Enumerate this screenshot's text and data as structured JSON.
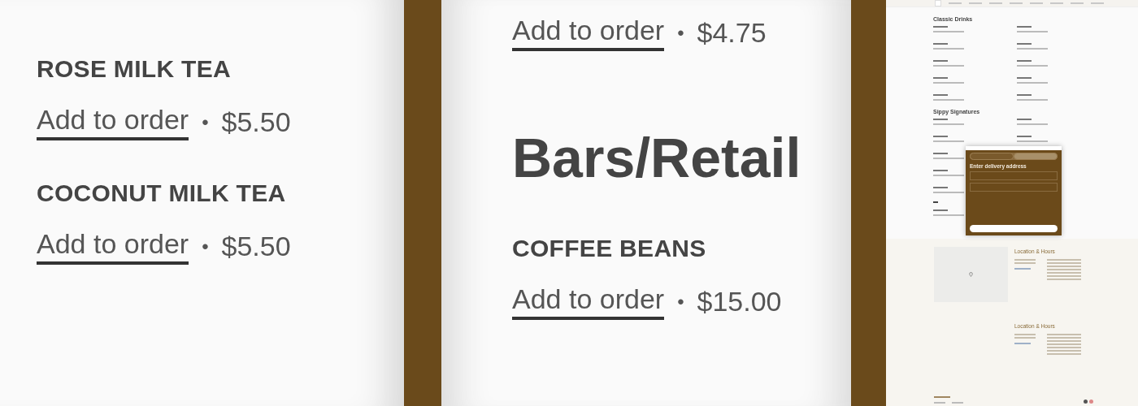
{
  "panel_left": {
    "items": [
      {
        "name": "ROSE MILK TEA",
        "link": "Add to order",
        "separator": "•",
        "price": "$5.50"
      },
      {
        "name": "COCONUT MILK TEA",
        "link": "Add to order",
        "separator": "•",
        "price": "$5.50"
      }
    ]
  },
  "panel_middle": {
    "top_item": {
      "link": "Add to order",
      "separator": "•",
      "price": "$4.75"
    },
    "heading": "Bars/Retail",
    "items": [
      {
        "name": "COFFEE BEANS",
        "link": "Add to order",
        "separator": "•",
        "price": "$15.00"
      }
    ]
  },
  "page_thumbnail": {
    "sections": [
      {
        "title": "Classic Drinks"
      },
      {
        "title": "Sippy Signatures"
      }
    ],
    "dialog": {
      "tabs": [
        {
          "selected": false
        },
        {
          "selected": true
        }
      ],
      "title": "Enter delivery address"
    },
    "locations": [
      {
        "title": "Location & Hours",
        "map": true
      },
      {
        "title": "Location & Hours",
        "map": false
      }
    ]
  }
}
